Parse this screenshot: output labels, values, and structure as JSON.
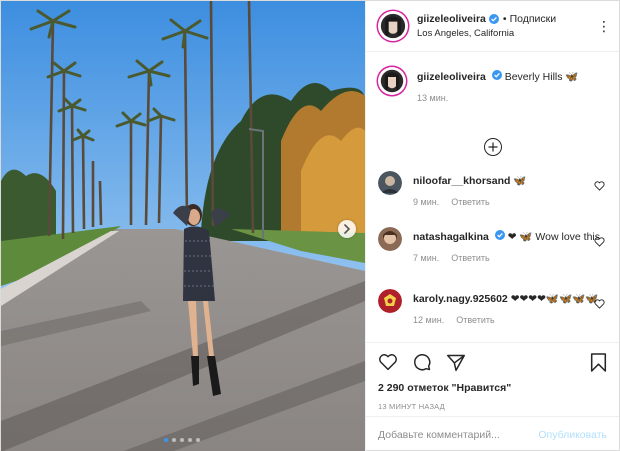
{
  "post": {
    "author": "giizeleoliveira",
    "follow_sep": "•",
    "follow_state": "Подписки",
    "location": "Los Angeles, California",
    "more_icon": "⋮",
    "caption": "Beverly Hills 🦋",
    "caption_time": "13 мин.",
    "comments": [
      {
        "user": "niloofar__khorsand",
        "text": "🦋",
        "time": "9 мин.",
        "reply": "Ответить"
      },
      {
        "user": "natashagalkina",
        "text": "❤ 🦋 Wow love this",
        "time": "7 мин.",
        "reply": "Ответить"
      },
      {
        "user": "karoly.nagy.925602",
        "text": "❤❤❤❤🦋🦋🦋🦋",
        "time": "12 мин.",
        "reply": "Ответить"
      }
    ],
    "likes": "2 290 отметок \"Нравится\"",
    "time_ago": "13 МИНУТ НАЗАД",
    "comment_placeholder": "Добавьте комментарий...",
    "post_label": "Опубликовать",
    "carousel": {
      "count": 5,
      "active_index": 0
    }
  },
  "colors": {
    "accent": "#3897f0",
    "post_button_disabled": "#b2dffc",
    "muted": "#8e8e8e",
    "text": "#262626"
  }
}
